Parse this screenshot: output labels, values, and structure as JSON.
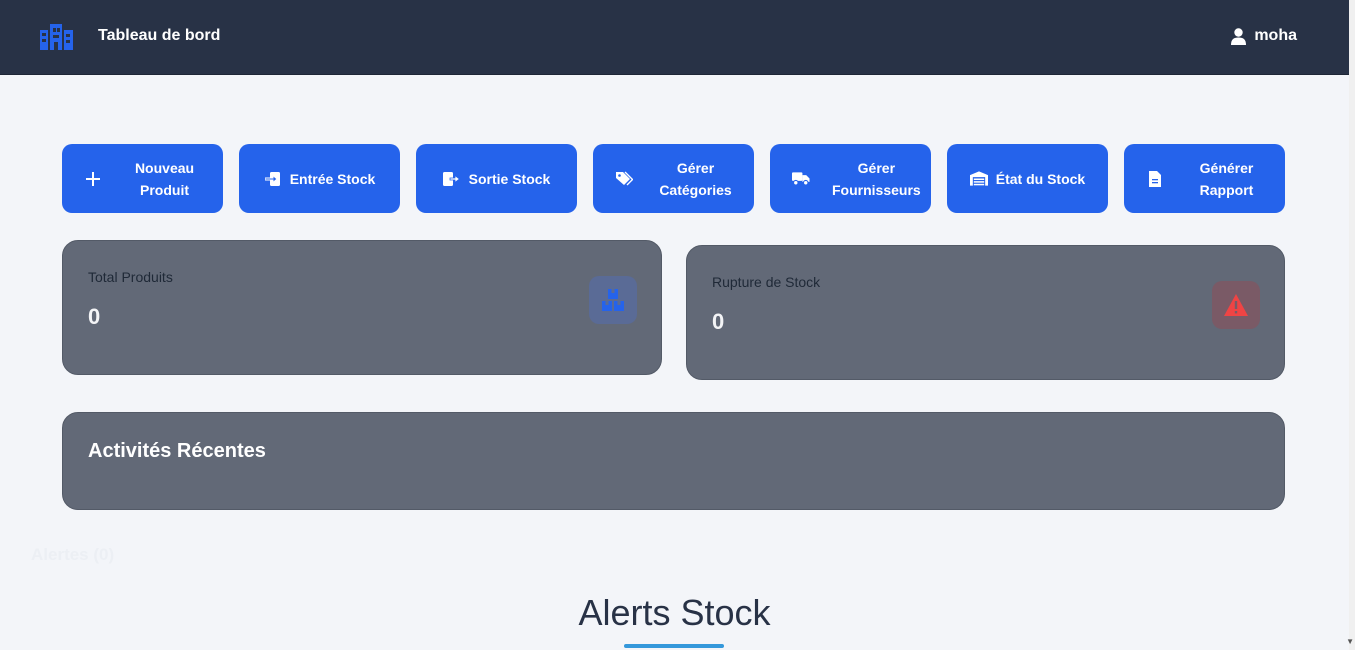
{
  "header": {
    "title": "Tableau de bord",
    "user": "moha"
  },
  "actions": [
    {
      "label": "Nouveau Produit",
      "icon": "plus-icon"
    },
    {
      "label": "Entrée Stock",
      "icon": "sign-in-icon"
    },
    {
      "label": "Sortie Stock",
      "icon": "sign-out-icon"
    },
    {
      "label": "Gérer Catégories",
      "icon": "tags-icon"
    },
    {
      "label": "Gérer Fournisseurs",
      "icon": "truck-icon"
    },
    {
      "label": "État du Stock",
      "icon": "warehouse-icon"
    },
    {
      "label": "Générer Rapport",
      "icon": "file-icon"
    }
  ],
  "stats": {
    "total": {
      "label": "Total Produits",
      "value": "0",
      "icon": "boxes-icon"
    },
    "rupture": {
      "label": "Rupture de Stock",
      "value": "0",
      "icon": "warning-icon"
    }
  },
  "activity": {
    "title": "Activités Récentes"
  },
  "alerts_label": "Alertes (0)",
  "alerts_section": {
    "title": "Alerts Stock"
  },
  "colors": {
    "navbar": "#283246",
    "primary": "#2563eb",
    "card": "#626977",
    "danger": "#ef4444",
    "underline": "#3498db"
  }
}
